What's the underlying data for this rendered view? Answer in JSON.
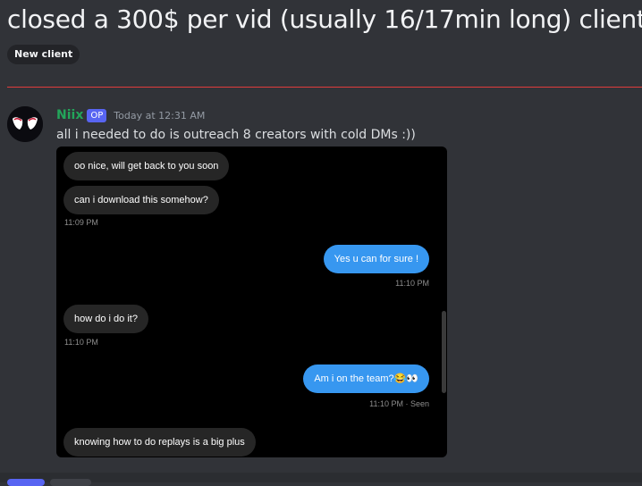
{
  "post": {
    "title": "closed a 300$ per vid (usually 16/17min long) client",
    "tag": "New client"
  },
  "message": {
    "author": "Niix",
    "op_badge": "OP",
    "timestamp": "Today at 12:31 AM",
    "text": "all i needed to do is outreach 8 creators with cold DMs :))"
  },
  "chat": {
    "messages": [
      {
        "side": "received",
        "text": "oo nice, will get back to you soon"
      },
      {
        "side": "received",
        "text": "can i download this somehow?"
      },
      {
        "side": "time",
        "text": "11:09 PM"
      },
      {
        "side": "sent",
        "text": "Yes u can for sure !"
      },
      {
        "side": "time",
        "text": "11:10 PM"
      },
      {
        "side": "received",
        "text": "how do i do it?"
      },
      {
        "side": "time",
        "text": "11:10 PM"
      },
      {
        "side": "sent",
        "text": "Am i on the team?😂👀"
      },
      {
        "side": "time",
        "text": "11:10 PM · Seen"
      },
      {
        "side": "received",
        "text": "knowing how to do replays is a big plus"
      }
    ]
  },
  "colors": {
    "sent_bubble": "#3797f0",
    "received_bubble": "#262626",
    "author": "#23a55a",
    "divider": "#e03c3c"
  }
}
